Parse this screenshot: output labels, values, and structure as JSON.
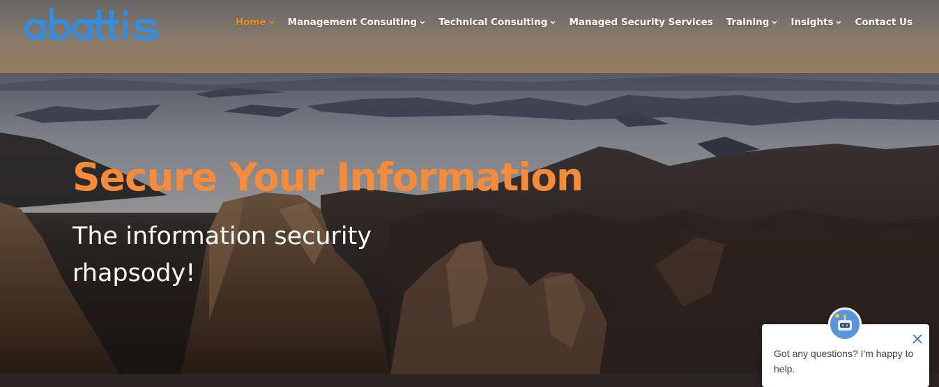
{
  "brand": {
    "logo_text": "abattis",
    "logo_color": "#2f8fe6"
  },
  "nav": {
    "items": [
      {
        "label": "Home",
        "has_dropdown": true,
        "active": true
      },
      {
        "label": "Management Consulting",
        "has_dropdown": true,
        "active": false
      },
      {
        "label": "Technical Consulting",
        "has_dropdown": true,
        "active": false
      },
      {
        "label": "Managed Security Services",
        "has_dropdown": false,
        "active": false
      },
      {
        "label": "Training",
        "has_dropdown": true,
        "active": false
      },
      {
        "label": "Insights",
        "has_dropdown": true,
        "active": false
      },
      {
        "label": "Contact Us",
        "has_dropdown": false,
        "active": false
      }
    ],
    "active_color": "#f28a2e"
  },
  "hero": {
    "headline": "Secure Your Information",
    "subhead": "The information security rhapsody!",
    "headline_color": "#f68c3a"
  },
  "chat": {
    "message": "Got any questions? I'm happy to help.",
    "close_icon": "close-icon",
    "avatar_icon": "bot-avatar-icon"
  }
}
